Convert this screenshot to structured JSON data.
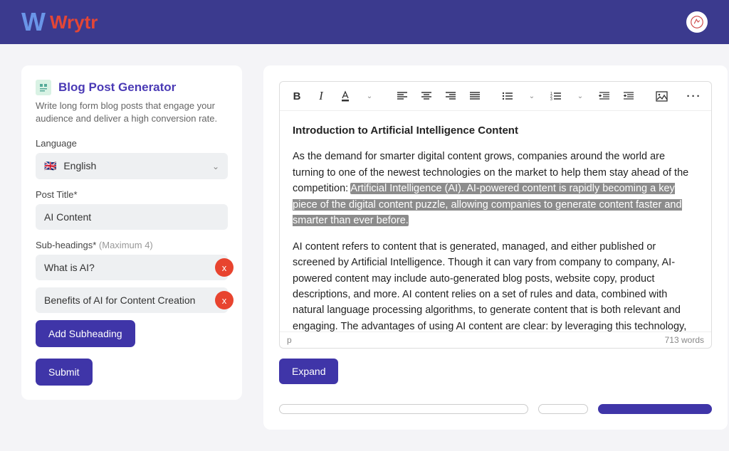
{
  "header": {
    "logo_mark": "W",
    "logo_text": "Wrytr"
  },
  "sidebar": {
    "tool_title": "Blog Post Generator",
    "tool_desc": "Write long form blog posts that engage your audience and deliver a high conversion rate.",
    "language_label": "Language",
    "language_value": "English",
    "post_title_label": "Post Title*",
    "post_title_value": "AI Content",
    "sub_label": "Sub-headings*",
    "sub_hint": "(Maximum 4)",
    "subheadings": [
      "What is AI?",
      "Benefits of AI for Content Creation"
    ],
    "add_sub_label": "Add Subheading",
    "submit_label": "Submit"
  },
  "editor": {
    "heading": "Introduction to Artificial Intelligence Content",
    "p1_a": "As the demand for smarter digital content grows, companies around the world are turning to one of the newest technologies on the market to help them stay ahead of the competition: ",
    "p1_hl": "Artificial Intelligence (AI). AI-powered content is rapidly becoming a key piece of the digital content puzzle, allowing companies to generate content faster and smarter than ever before.",
    "p2": "AI content refers to content that is generated, managed, and either published or screened by Artificial Intelligence. Though it can vary from company to company, AI-powered content may include auto-generated blog posts, website copy, product descriptions, and more. AI content relies on a set of rules and data, combined with natural language processing algorithms, to generate content that is both relevant and engaging. The advantages of using AI content are clear: by leveraging this technology, businesses can save time and resources while still producing high-quality, optimized content that speaks directly to their target audience. Thanks to AI, businesses can also focus on generating more engaging and accurate content, as AI helps to reduce the risk of errors and typos",
    "path_indicator": "p",
    "word_count": "713 words",
    "expand_label": "Expand"
  }
}
